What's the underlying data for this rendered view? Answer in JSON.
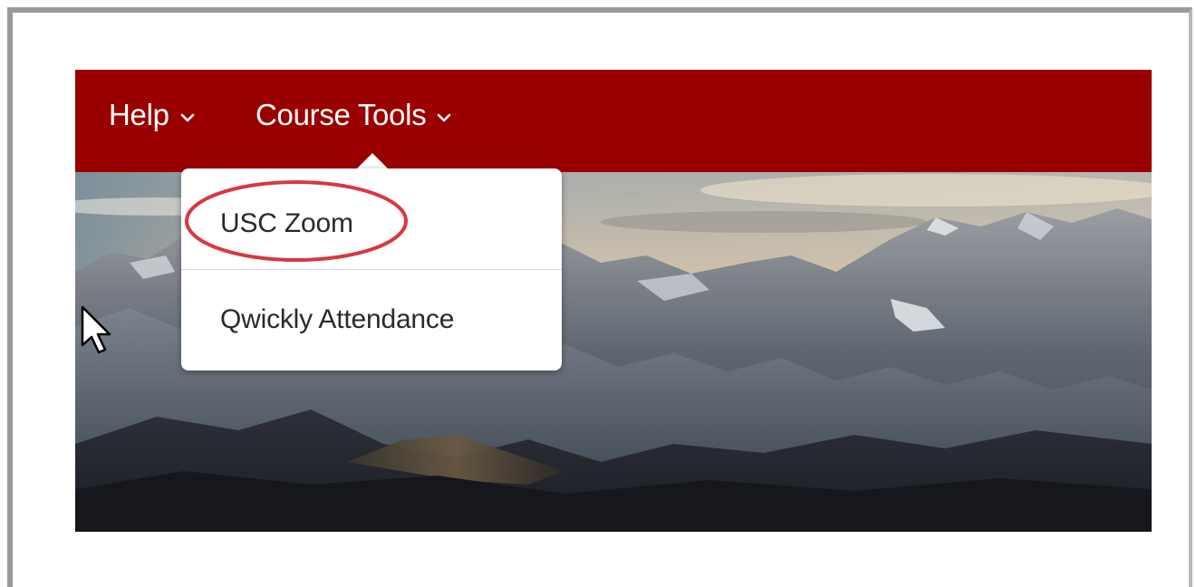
{
  "navbar": {
    "items": [
      {
        "label": "Help",
        "icon": "chevron-down-icon"
      },
      {
        "label": "Course Tools",
        "icon": "chevron-down-icon"
      }
    ]
  },
  "dropdown": {
    "items": [
      {
        "label": "USC Zoom",
        "highlighted": true
      },
      {
        "label": "Qwickly Attendance"
      }
    ]
  },
  "colors": {
    "navbar": "#9b0000",
    "highlight": "#d9373f",
    "menu_text": "#2a2a2a"
  }
}
